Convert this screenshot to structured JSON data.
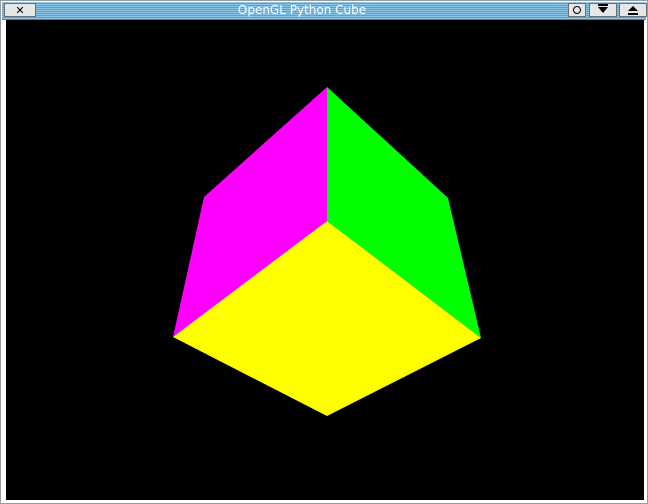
{
  "window": {
    "title": "OpenGL Python Cube",
    "buttons": {
      "close": "✕",
      "shade_icon": "circle-icon",
      "minimize_icon": "arrow-down-icon",
      "maximize_icon": "eject-icon"
    }
  },
  "scene": {
    "background_color": "#000000",
    "faces": [
      {
        "name": "left-face",
        "color": "#ff00ff"
      },
      {
        "name": "right-face",
        "color": "#00ff00"
      },
      {
        "name": "front-face",
        "color": "#ffff00"
      }
    ]
  }
}
